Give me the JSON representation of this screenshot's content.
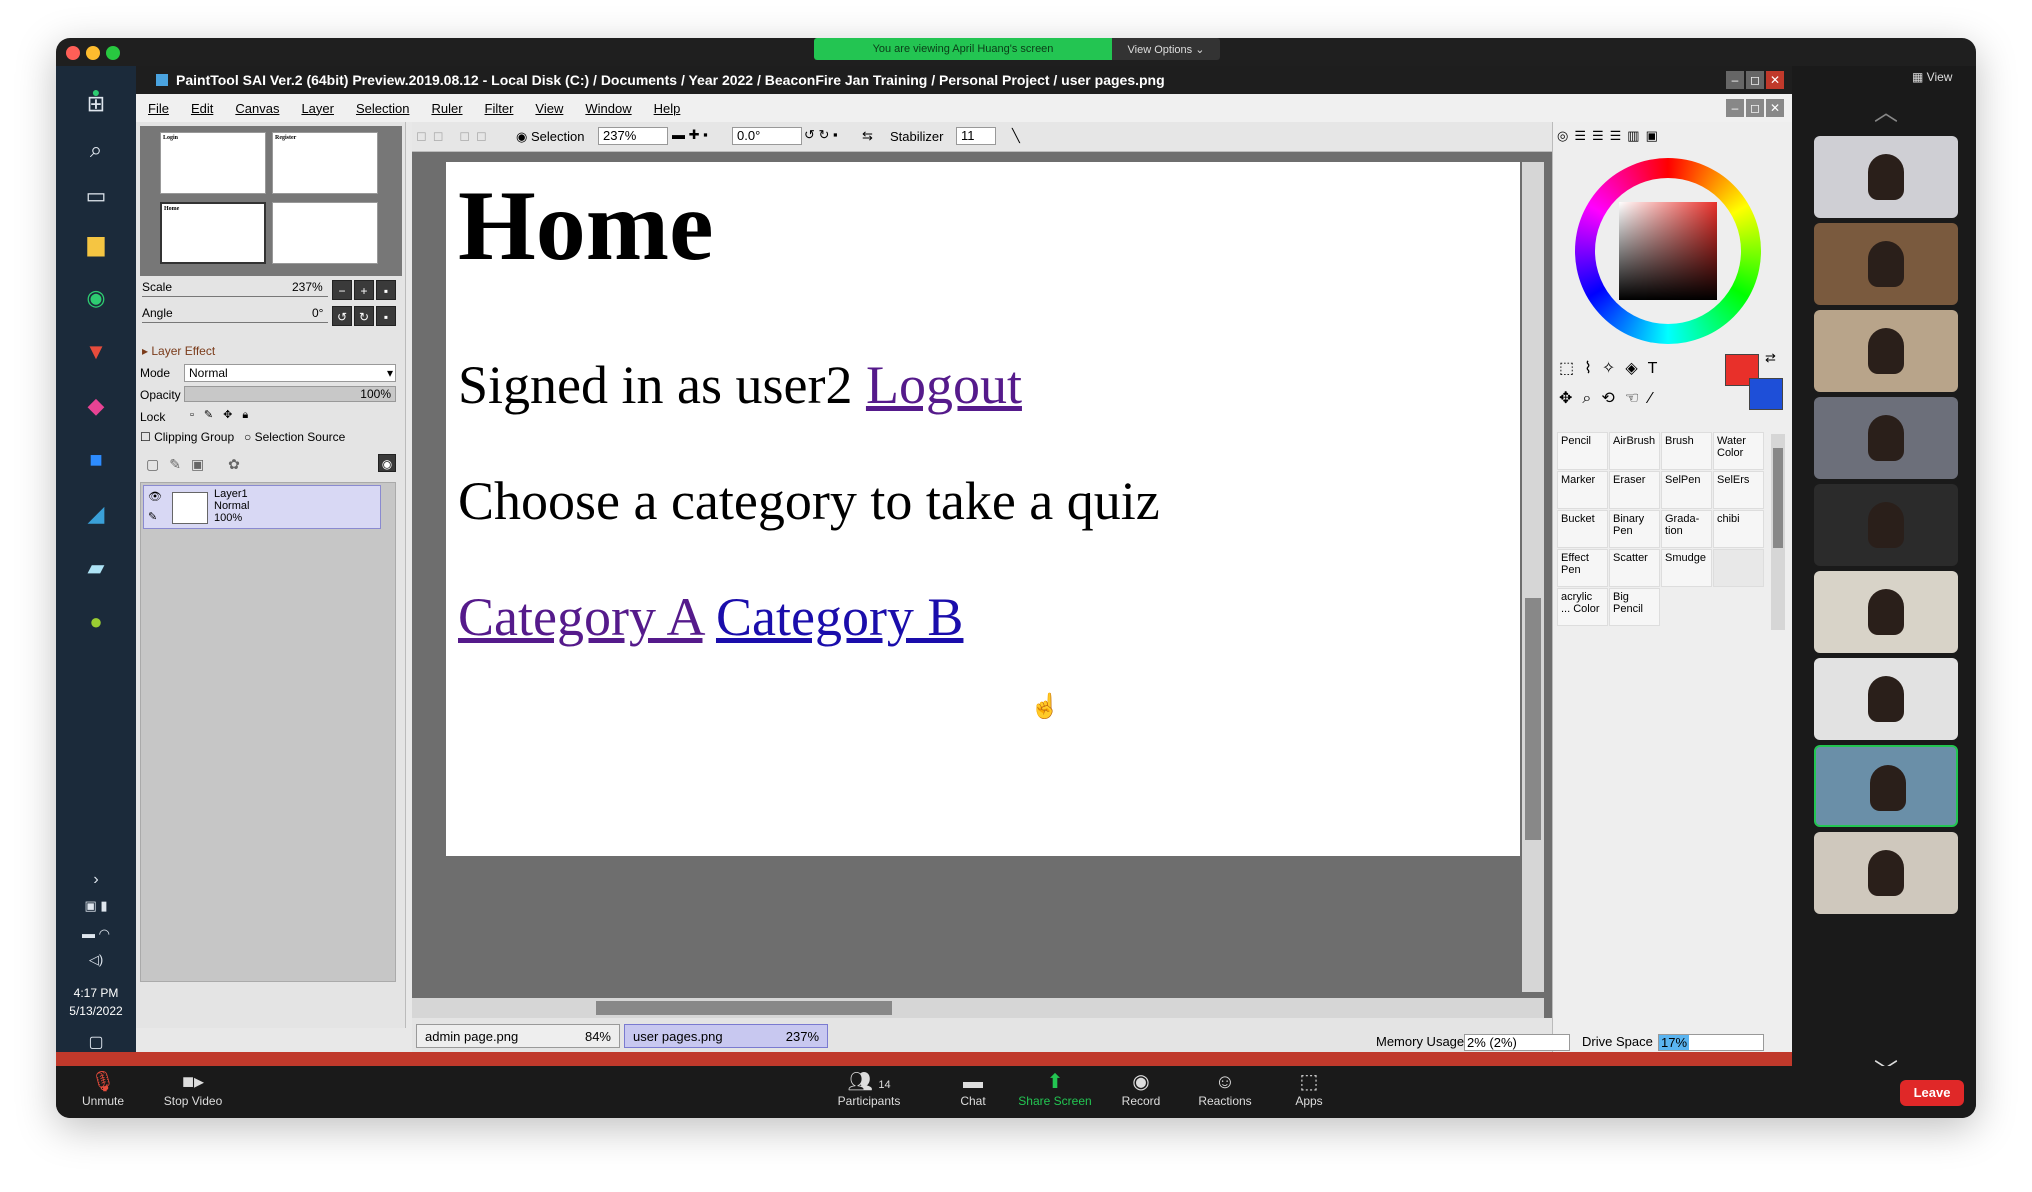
{
  "share_banner": {
    "message": "You are viewing April Huang's screen",
    "options": "View Options ⌄"
  },
  "view_label": "View",
  "taskbar": {
    "time": "4:17 PM",
    "date": "5/13/2022"
  },
  "sai": {
    "title": "PaintTool SAI Ver.2 (64bit) Preview.2019.08.12 - Local Disk (C:) / Documents / Year 2022 / BeaconFire Jan Training / Personal Project / user pages.png",
    "menu": [
      "File",
      "Edit",
      "Canvas",
      "Layer",
      "Selection",
      "Ruler",
      "Filter",
      "View",
      "Window",
      "Help"
    ],
    "toolbar": {
      "selection_label": "Selection",
      "zoom": "237%",
      "angle": "0.0°",
      "stabilizer_label": "Stabilizer",
      "stabilizer_value": "11"
    },
    "navigator": {
      "thumbs": [
        {
          "title": "Login"
        },
        {
          "title": "Register"
        },
        {
          "title": "Home"
        },
        {
          "title": ""
        }
      ]
    },
    "scale": {
      "label": "Scale",
      "value": "237%"
    },
    "angle": {
      "label": "Angle",
      "value": "0°"
    },
    "layer_effect": "Layer Effect",
    "mode": {
      "label": "Mode",
      "value": "Normal"
    },
    "opacity": {
      "label": "Opacity",
      "value": "100%"
    },
    "lock_label": "Lock",
    "clipping_group": "Clipping Group",
    "selection_source": "Selection Source",
    "layer": {
      "name": "Layer1",
      "mode": "Normal",
      "opacity": "100%"
    },
    "canvas": {
      "heading": "Home",
      "signed_in_text": "Signed in as user2",
      "logout_link": "Logout",
      "prompt": "Choose a category to take a quiz",
      "category_a": "Category A",
      "category_b": "Category B"
    },
    "doc_tabs": [
      {
        "name": "admin page.png",
        "zoom": "84%"
      },
      {
        "name": "user pages.png",
        "zoom": "237%"
      }
    ],
    "tools": [
      [
        "Pencil",
        "AirBrush",
        "Brush",
        "Water Color"
      ],
      [
        "Marker",
        "Eraser",
        "SelPen",
        "SelErs"
      ],
      [
        "Bucket",
        "Binary Pen",
        "Grada-tion",
        "chibi"
      ],
      [
        "Effect Pen",
        "Scatter",
        "Smudge",
        ""
      ],
      [
        "acrylic ... Color",
        "Big Pencil",
        "",
        ""
      ]
    ],
    "colors": {
      "primary": "#e8302a",
      "secondary": "#1e4fd8"
    },
    "status": {
      "memory_label": "Memory Usage",
      "memory_value": "2% (2%)",
      "drive_label": "Drive Space",
      "drive_value": "17%"
    }
  },
  "zoom_bar": {
    "unmute": "Unmute",
    "stop_video": "Stop Video",
    "participants": "Participants",
    "participants_count": "14",
    "chat": "Chat",
    "share_screen": "Share Screen",
    "record": "Record",
    "reactions": "Reactions",
    "apps": "Apps",
    "leave": "Leave"
  },
  "participant_videos": [
    {
      "bg": "#cfcfd4"
    },
    {
      "bg": "#7a5a3e"
    },
    {
      "bg": "#b8a48a"
    },
    {
      "bg": "#6c6f7a"
    },
    {
      "bg": "#2b2b2b"
    },
    {
      "bg": "#d8d3c8"
    },
    {
      "bg": "#e2e2e2"
    },
    {
      "bg": "#6a8fa8"
    },
    {
      "bg": "#cfc8bd"
    }
  ]
}
